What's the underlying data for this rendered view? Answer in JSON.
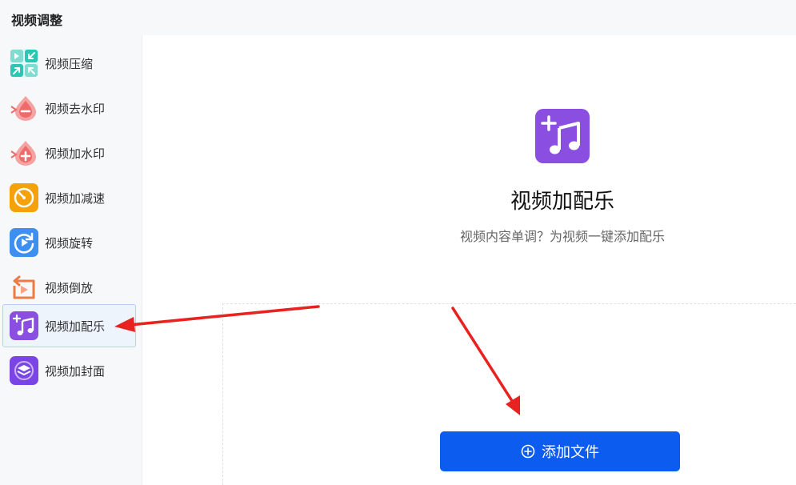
{
  "header": {
    "title": "视频调整"
  },
  "sidebar": {
    "items": [
      {
        "label": "视频压缩",
        "icon": "compress-icon",
        "color": "#2bc6b4",
        "active": false
      },
      {
        "label": "视频去水印",
        "icon": "watermark-remove-icon",
        "color": "#ef6b6b",
        "active": false
      },
      {
        "label": "视频加水印",
        "icon": "watermark-add-icon",
        "color": "#ef6b6b",
        "active": false
      },
      {
        "label": "视频加减速",
        "icon": "speedometer-icon",
        "color": "#f5a20a",
        "active": false
      },
      {
        "label": "视频旋转",
        "icon": "rotate-icon",
        "color": "#3d8ff0",
        "active": false
      },
      {
        "label": "视频倒放",
        "icon": "reverse-play-icon",
        "color": "#ef7b44",
        "active": false
      },
      {
        "label": "视频加配乐",
        "icon": "music-add-icon",
        "color": "#8a4fe0",
        "active": true
      },
      {
        "label": "视频加封面",
        "icon": "cover-layers-icon",
        "color": "#7b45e6",
        "active": false
      }
    ]
  },
  "main": {
    "hero_icon": "music-add-icon",
    "title": "视频加配乐",
    "subtitle": "视频内容单调？为视频一键添加配乐",
    "add_button_label": "添加文件",
    "add_button_icon": "plus-circle-icon"
  },
  "annotations": {
    "arrow_color": "#e8231f"
  }
}
